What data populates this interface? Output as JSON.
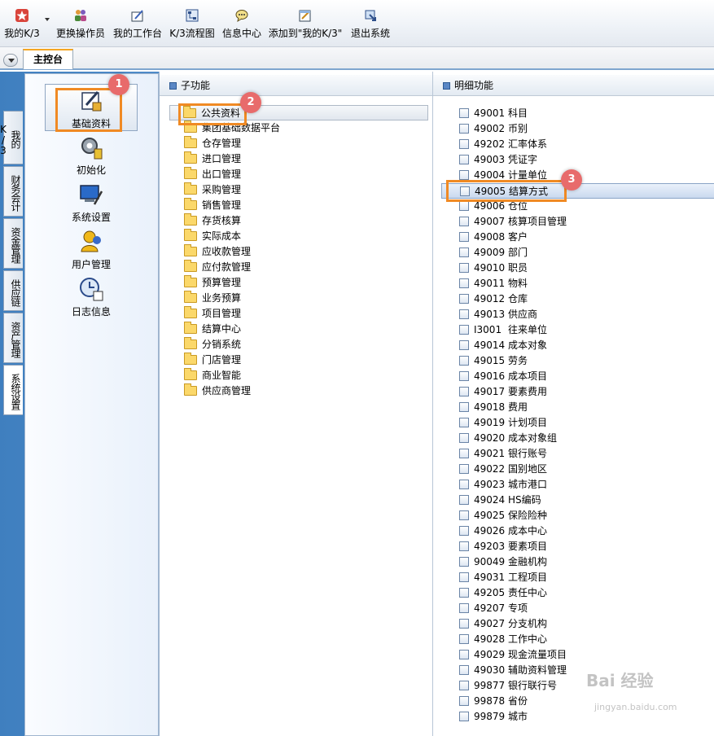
{
  "toolbar": {
    "items": [
      {
        "label": "我的K/3",
        "icon": "star-icon"
      },
      {
        "label": "更换操作员",
        "icon": "switch-user-icon"
      },
      {
        "label": "我的工作台",
        "icon": "workbench-icon"
      },
      {
        "label": "K/3流程图",
        "icon": "flowchart-icon"
      },
      {
        "label": "信息中心",
        "icon": "message-icon"
      },
      {
        "label": "添加到\"我的K/3\"",
        "icon": "add-favorite-icon"
      },
      {
        "label": "退出系统",
        "icon": "exit-icon"
      }
    ]
  },
  "tabs": {
    "main": "主控台"
  },
  "side_tabs": [
    "我的K/3",
    "财务会计",
    "资金管理",
    "供应链",
    "资产管理",
    "系统设置"
  ],
  "left_menu": [
    {
      "label": "基础资料",
      "icon": "basic-data-icon"
    },
    {
      "label": "初始化",
      "icon": "initialize-icon"
    },
    {
      "label": "系统设置",
      "icon": "system-settings-icon"
    },
    {
      "label": "用户管理",
      "icon": "user-management-icon"
    },
    {
      "label": "日志信息",
      "icon": "log-info-icon"
    }
  ],
  "sub_panel": {
    "title": "子功能",
    "items": [
      "公共资料",
      "集团基础数据平台",
      "仓存管理",
      "进口管理",
      "出口管理",
      "采购管理",
      "销售管理",
      "存货核算",
      "实际成本",
      "应收款管理",
      "应付款管理",
      "预算管理",
      "业务预算",
      "项目管理",
      "结算中心",
      "分销系统",
      "门店管理",
      "商业智能",
      "供应商管理"
    ]
  },
  "detail_panel": {
    "title": "明细功能",
    "items": [
      {
        "code": "49001",
        "name": "科目"
      },
      {
        "code": "49002",
        "name": "币别"
      },
      {
        "code": "49202",
        "name": "汇率体系"
      },
      {
        "code": "49003",
        "name": "凭证字"
      },
      {
        "code": "49004",
        "name": "计量单位"
      },
      {
        "code": "49005",
        "name": "结算方式"
      },
      {
        "code": "49006",
        "name": "仓位"
      },
      {
        "code": "49007",
        "name": "核算项目管理"
      },
      {
        "code": "49008",
        "name": "客户"
      },
      {
        "code": "49009",
        "name": "部门"
      },
      {
        "code": "49010",
        "name": "职员"
      },
      {
        "code": "49011",
        "name": "物料"
      },
      {
        "code": "49012",
        "name": "仓库"
      },
      {
        "code": "49013",
        "name": "供应商"
      },
      {
        "code": "I3001",
        "name": "往来单位"
      },
      {
        "code": "49014",
        "name": "成本对象"
      },
      {
        "code": "49015",
        "name": "劳务"
      },
      {
        "code": "49016",
        "name": "成本项目"
      },
      {
        "code": "49017",
        "name": "要素费用"
      },
      {
        "code": "49018",
        "name": "费用"
      },
      {
        "code": "49019",
        "name": "计划项目"
      },
      {
        "code": "49020",
        "name": "成本对象组"
      },
      {
        "code": "49021",
        "name": "银行账号"
      },
      {
        "code": "49022",
        "name": "国别地区"
      },
      {
        "code": "49023",
        "name": "城市港口"
      },
      {
        "code": "49024",
        "name": "HS编码"
      },
      {
        "code": "49025",
        "name": "保险险种"
      },
      {
        "code": "49026",
        "name": "成本中心"
      },
      {
        "code": "49203",
        "name": "要素项目"
      },
      {
        "code": "90049",
        "name": "金融机构"
      },
      {
        "code": "49031",
        "name": "工程项目"
      },
      {
        "code": "49205",
        "name": "责任中心"
      },
      {
        "code": "49207",
        "name": "专项"
      },
      {
        "code": "49027",
        "name": "分支机构"
      },
      {
        "code": "49028",
        "name": "工作中心"
      },
      {
        "code": "49029",
        "name": "现金流量项目"
      },
      {
        "code": "49030",
        "name": "辅助资料管理"
      },
      {
        "code": "99877",
        "name": "银行联行号"
      },
      {
        "code": "99878",
        "name": "省份"
      },
      {
        "code": "99879",
        "name": "城市"
      }
    ]
  },
  "annotations": [
    "1",
    "2",
    "3"
  ],
  "watermark": {
    "line1": "Bai 经验",
    "line2": "jingyan.baidu.com"
  },
  "colors": {
    "highlight": "#f08a24",
    "badge": "#e86b6b"
  }
}
